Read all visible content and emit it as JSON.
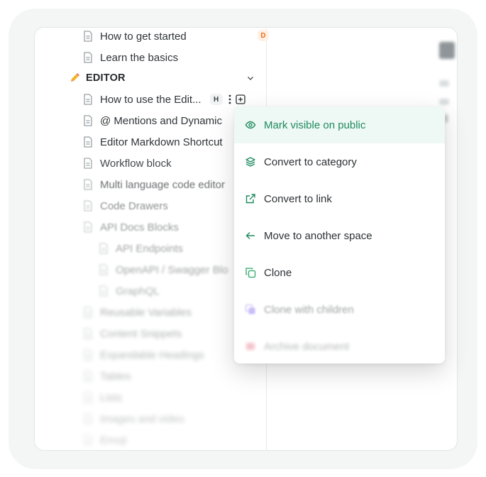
{
  "sidebar": {
    "items": [
      {
        "label": "How to get started",
        "badge": "D"
      },
      {
        "label": "Learn the basics"
      },
      {
        "label": "EDITOR"
      },
      {
        "label": "How to use the Edit...",
        "badge": "H"
      },
      {
        "label": "@ Mentions and Dynamic"
      },
      {
        "label": "Editor Markdown Shortcut"
      },
      {
        "label": "Workflow block"
      },
      {
        "label": "Multi language code editor"
      },
      {
        "label": "Code Drawers"
      },
      {
        "label": "API Docs Blocks"
      },
      {
        "label": "API Endpoints"
      },
      {
        "label": "OpenAPI / Swagger Blo"
      },
      {
        "label": "GraphQL"
      },
      {
        "label": "Reusable Variables"
      },
      {
        "label": "Content Snippets"
      },
      {
        "label": "Expandable Headings"
      },
      {
        "label": "Tables"
      },
      {
        "label": "Lists"
      },
      {
        "label": "Images and video"
      },
      {
        "label": "Emoji"
      }
    ]
  },
  "context_menu": {
    "items": [
      {
        "label": "Mark visible on public",
        "icon": "eye-icon"
      },
      {
        "label": "Convert to category",
        "icon": "layers-icon"
      },
      {
        "label": "Convert to link",
        "icon": "external-link-icon"
      },
      {
        "label": "Move to another space",
        "icon": "arrow-left-icon"
      },
      {
        "label": "Clone",
        "icon": "copy-icon"
      },
      {
        "label": "Clone with children",
        "icon": "copy-children-icon"
      },
      {
        "label": "Archive document",
        "icon": "archive-icon"
      }
    ]
  },
  "colors": {
    "accent_green": "#1f8a5f",
    "badge_orange": "#f06c16",
    "clone_children_purple": "#8b6cf0",
    "archive_red": "#e0586a"
  }
}
